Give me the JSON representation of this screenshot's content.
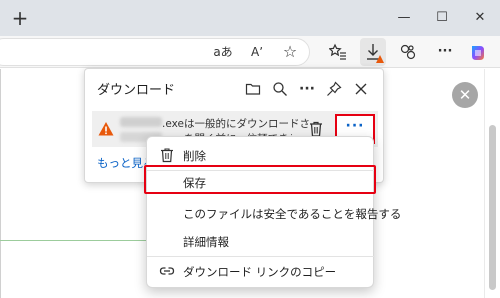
{
  "browser": {
    "new_tab_glyph": "+",
    "window_controls": [
      "—",
      "☐",
      "✕"
    ]
  },
  "toolbar": {
    "read_aloud_glyph": "aあ",
    "font_glyph": "Aʼ",
    "favorite_glyph": "☆",
    "collections_glyph": "☆≡",
    "more_glyph": "···"
  },
  "downloads_panel": {
    "title": "ダウンロード",
    "item": {
      "line1": ".exeは一般的にダウンロードされて",
      "line2": ".exeを開く前に、信頼できることを"
    },
    "more_button": "···",
    "see_more": "もっと見る"
  },
  "context_menu": {
    "items": [
      {
        "label": "削除",
        "icon": "trash-icon"
      },
      {
        "label": "保存",
        "icon": ""
      },
      {
        "label": "このファイルは安全であることを報告する",
        "icon": ""
      },
      {
        "label": "詳細情報",
        "icon": ""
      },
      {
        "label": "ダウンロード リンクのコピー",
        "icon": "link-icon"
      }
    ]
  },
  "page": {
    "close_glyph": "✕"
  },
  "colors": {
    "highlight": "#e60012",
    "link": "#0b63c7",
    "warning": "#e8590c"
  }
}
